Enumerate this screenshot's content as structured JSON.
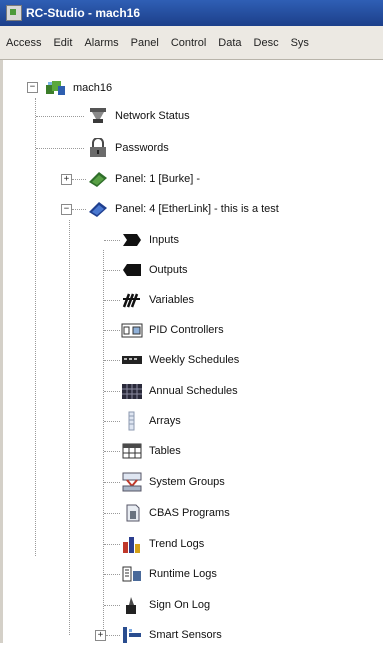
{
  "window": {
    "title": "RC-Studio - mach16"
  },
  "menu": [
    "Access",
    "Edit",
    "Alarms",
    "Panel",
    "Control",
    "Data",
    "Desc",
    "Sys"
  ],
  "tree": {
    "root": {
      "label": "mach16",
      "expanded": true,
      "icon": "network-icon"
    },
    "level1": [
      {
        "label": "Network Status",
        "icon": "network-status-icon"
      },
      {
        "label": "Passwords",
        "icon": "padlock-icon"
      },
      {
        "label": "Panel: 1 [Burke] -",
        "icon": "panel-icon",
        "expander": "+"
      },
      {
        "label": "Panel: 4 [EtherLink] - this is a test",
        "icon": "panel-etherlink-icon",
        "expander": "−"
      }
    ],
    "panel4_children": [
      {
        "label": "Inputs",
        "icon": "inputs-icon"
      },
      {
        "label": "Outputs",
        "icon": "outputs-icon"
      },
      {
        "label": "Variables",
        "icon": "variables-icon"
      },
      {
        "label": "PID Controllers",
        "icon": "pid-controllers-icon"
      },
      {
        "label": "Weekly Schedules",
        "icon": "weekly-schedules-icon"
      },
      {
        "label": "Annual Schedules",
        "icon": "annual-schedules-icon"
      },
      {
        "label": "Arrays",
        "icon": "arrays-icon"
      },
      {
        "label": "Tables",
        "icon": "tables-icon"
      },
      {
        "label": "System Groups",
        "icon": "system-groups-icon"
      },
      {
        "label": "CBAS Programs",
        "icon": "cbas-programs-icon"
      },
      {
        "label": "Trend Logs",
        "icon": "trend-logs-icon"
      },
      {
        "label": "Runtime Logs",
        "icon": "runtime-logs-icon"
      },
      {
        "label": "Sign On Log",
        "icon": "sign-on-log-icon"
      },
      {
        "label": "Smart Sensors",
        "icon": "smart-sensors-icon",
        "expander": "+"
      }
    ]
  }
}
